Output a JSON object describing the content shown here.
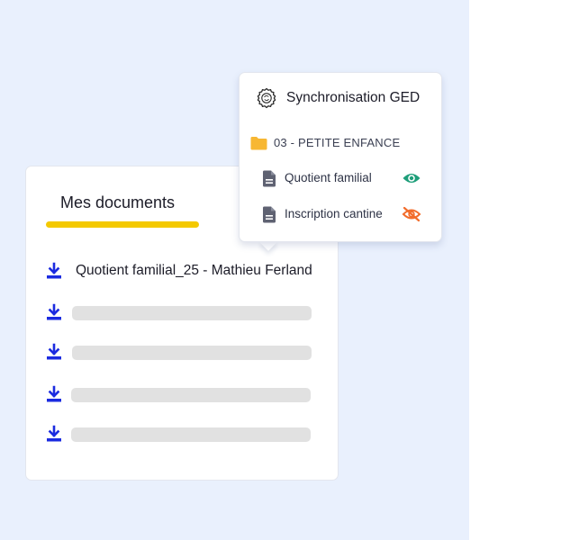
{
  "documents_card": {
    "title": "Mes documents",
    "accent_color": "#f4c900",
    "items": [
      {
        "icon": "download-icon",
        "name": "Quotient familial_25 - Mathieu Ferland"
      },
      {
        "icon": "download-icon",
        "name": ""
      },
      {
        "icon": "download-icon",
        "name": ""
      },
      {
        "icon": "download-icon",
        "name": ""
      },
      {
        "icon": "download-icon",
        "name": ""
      }
    ]
  },
  "ged_popup": {
    "icon": "gear-icon",
    "title": "Synchronisation GED",
    "folder": {
      "icon": "folder-icon",
      "label": "03 - PETITE ENFANCE",
      "color": "#f7b733"
    },
    "files": [
      {
        "icon": "document-icon",
        "label": "Quotient familial",
        "visibility": "visible",
        "visibility_icon": "eye-icon",
        "status_color": "#1e9e7a"
      },
      {
        "icon": "document-icon",
        "label": "Inscription cantine",
        "visibility": "hidden",
        "visibility_icon": "eye-off-icon",
        "status_color": "#f26c2b"
      }
    ]
  },
  "colors": {
    "background_panel": "#e9f0fd",
    "download_icon": "#1b2be0"
  }
}
